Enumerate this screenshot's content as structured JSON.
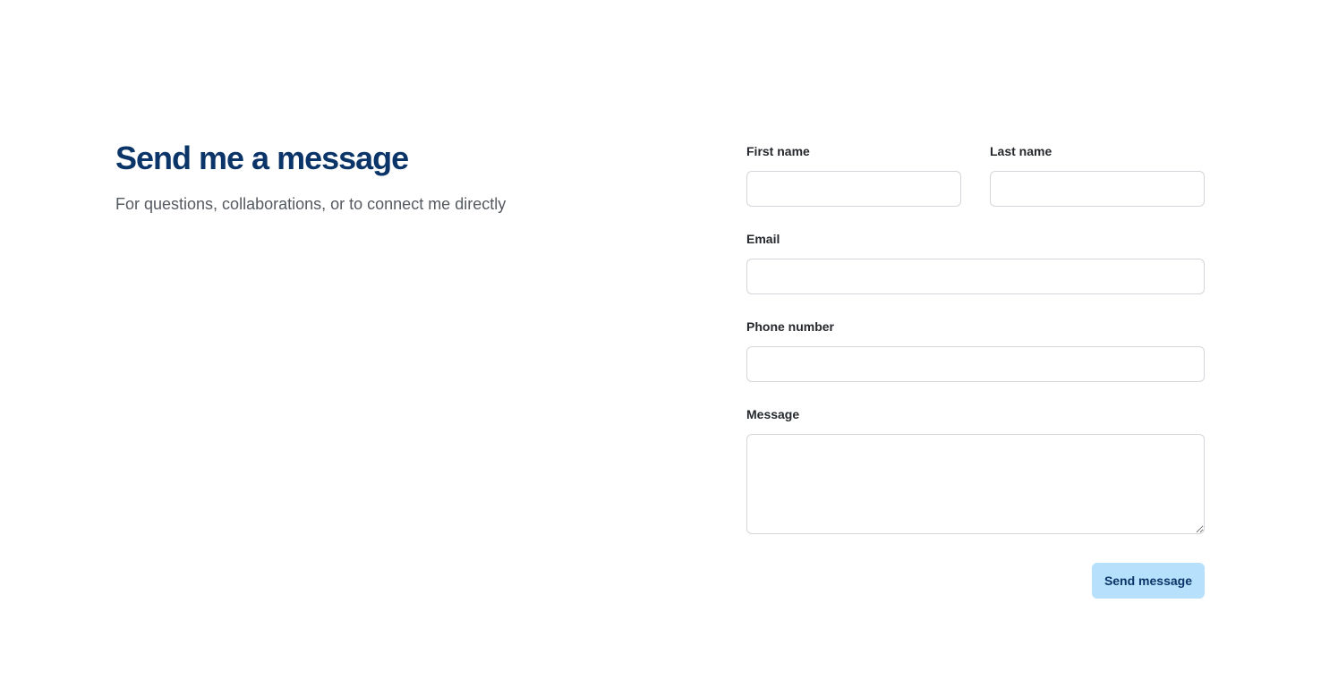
{
  "intro": {
    "title": "Send me a message",
    "subtitle": "For questions, collaborations, or to connect me directly"
  },
  "form": {
    "first_name_label": "First name",
    "first_name_value": "",
    "last_name_label": "Last name",
    "last_name_value": "",
    "email_label": "Email",
    "email_value": "",
    "phone_label": "Phone number",
    "phone_value": "",
    "message_label": "Message",
    "message_value": "",
    "submit_label": "Send message"
  },
  "colors": {
    "title": "#0b3568",
    "subtitle": "#555a60",
    "label": "#25282c",
    "input_border": "#d3d6da",
    "button_bg": "#b6e0fb",
    "button_text": "#0b3568"
  }
}
